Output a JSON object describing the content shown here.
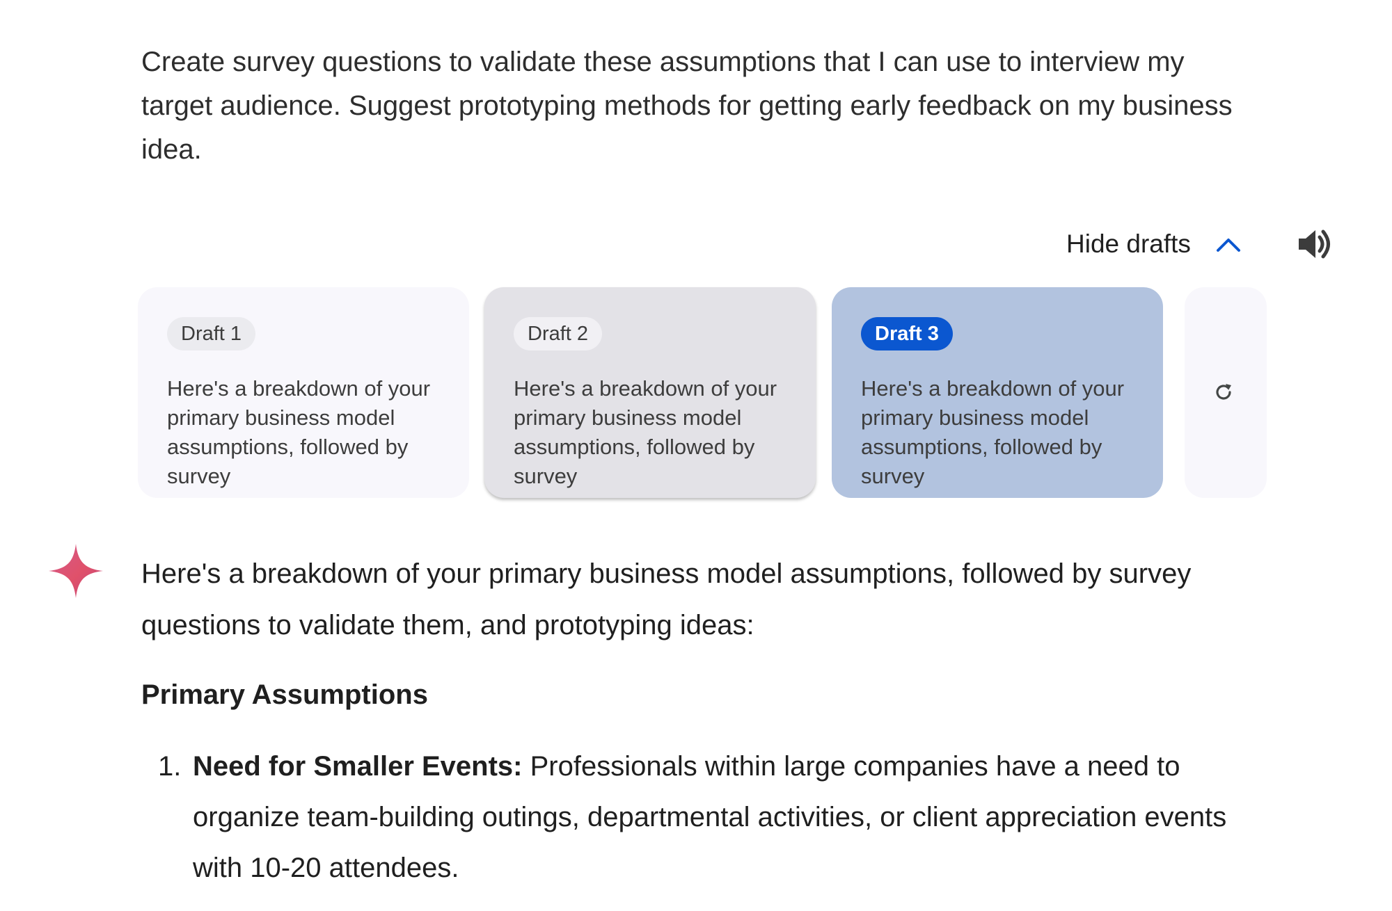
{
  "user_prompt": "Create survey questions to validate these assumptions that I can use to interview my target audience. Suggest prototyping methods for getting early feedback on my business idea.",
  "drafts_toggle": {
    "label": "Hide drafts",
    "chevron_icon": "chevron-up-icon"
  },
  "speaker_icon": "volume-icon",
  "drafts": [
    {
      "label": "Draft 1",
      "preview": "Here's a breakdown of your primary business model assumptions, followed by survey",
      "selected": false
    },
    {
      "label": "Draft 2",
      "preview": "Here's a breakdown of your primary business model assumptions, followed by survey",
      "selected": false
    },
    {
      "label": "Draft 3",
      "preview": "Here's a breakdown of your primary business model assumptions, followed by survey",
      "selected": true
    }
  ],
  "regenerate_icon": "refresh-icon",
  "response": {
    "intro": "Here's a breakdown of your primary business model assumptions, followed by survey questions to validate them, and prototyping ideas:",
    "section_heading": "Primary Assumptions",
    "assumptions": [
      {
        "number": "1.",
        "title": "Need for Smaller Events:",
        "text": " Professionals within large companies have a need to organize team-building outings, departmental activities, or client appreciation events with 10-20 attendees."
      }
    ]
  },
  "colors": {
    "accent_blue": "#0b57d0",
    "selected_card": "#b2c3df",
    "hover_card": "#e3e2e7",
    "card_bg": "#f8f7fc"
  }
}
